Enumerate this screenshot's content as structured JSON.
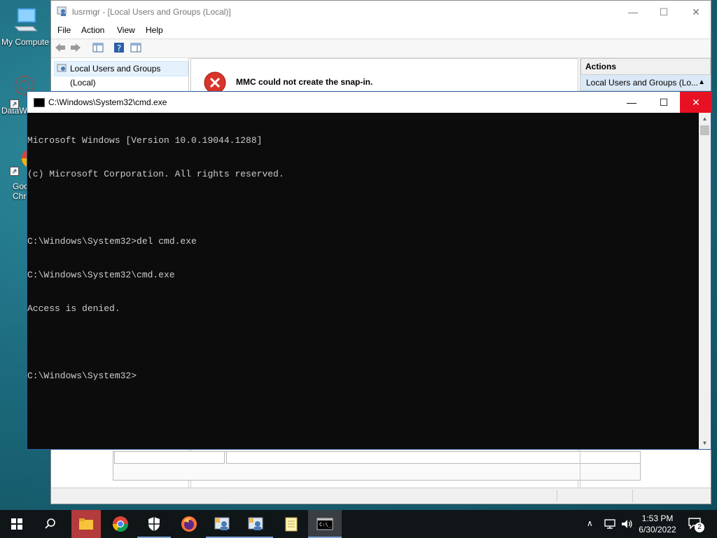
{
  "desktop": {
    "icons": [
      {
        "label": "My Compute"
      },
      {
        "label": "DataW"
      },
      {
        "label": "Goo"
      },
      {
        "label": "Chr"
      }
    ]
  },
  "mmc": {
    "title": "lusrmgr - [Local Users and Groups (Local)]",
    "menu": [
      "File",
      "Action",
      "View",
      "Help"
    ],
    "tree_item": "Local Users and Groups (Local)",
    "error_message": "MMC could not create the snap-in.",
    "actions_header": "Actions",
    "actions_item": "Local Users and Groups (Lo..."
  },
  "cmd": {
    "title": "C:\\Windows\\System32\\cmd.exe",
    "lines": [
      "Microsoft Windows [Version 10.0.19044.1288]",
      "(c) Microsoft Corporation. All rights reserved.",
      "",
      "C:\\Windows\\System32>del cmd.exe",
      "C:\\Windows\\System32\\cmd.exe",
      "Access is denied.",
      "",
      "C:\\Windows\\System32>"
    ]
  },
  "taskbar": {
    "time": "1:53 PM",
    "date": "6/30/2022",
    "notification_count": "2",
    "apps": [
      "file-explorer",
      "chrome",
      "security",
      "firefox",
      "mmc-1",
      "mmc-2",
      "notepad",
      "cmd"
    ]
  }
}
